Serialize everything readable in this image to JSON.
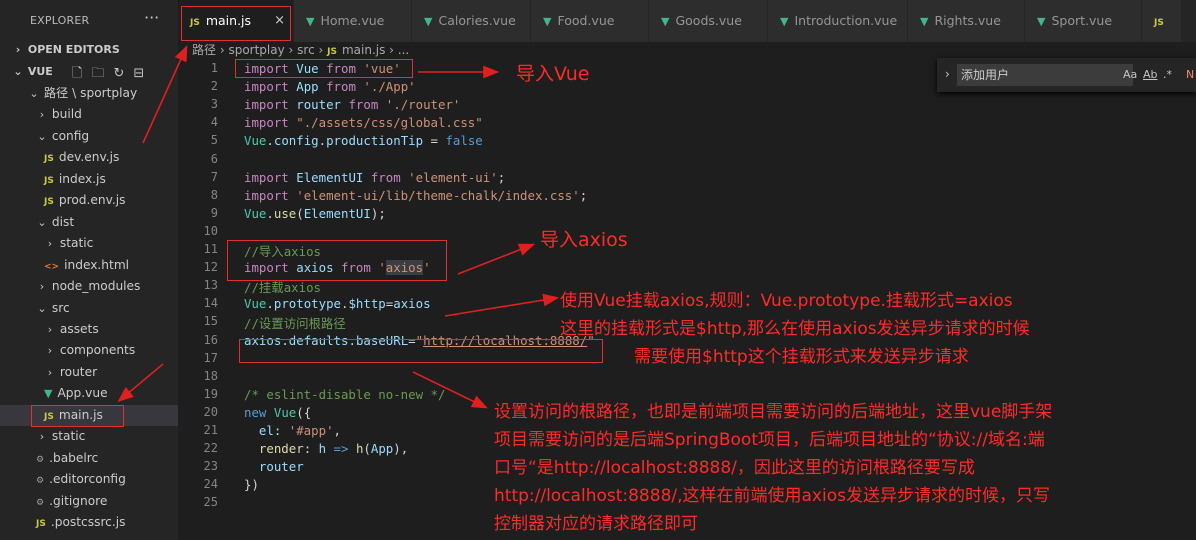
{
  "explorer": {
    "title": "EXPLORER",
    "more": "···",
    "open_editors": "OPEN EDITORS",
    "workspace": "VUE",
    "tree": [
      {
        "label": "路径 \\ sportplay",
        "type": "folder-open",
        "depth": 1
      },
      {
        "label": "build",
        "type": "folder",
        "depth": 2
      },
      {
        "label": "config",
        "type": "folder-open",
        "depth": 2
      },
      {
        "label": "dev.env.js",
        "type": "js",
        "depth": 3
      },
      {
        "label": "index.js",
        "type": "js",
        "depth": 3
      },
      {
        "label": "prod.env.js",
        "type": "js",
        "depth": 3
      },
      {
        "label": "dist",
        "type": "folder-open",
        "depth": 2
      },
      {
        "label": "static",
        "type": "folder",
        "depth": 3
      },
      {
        "label": "index.html",
        "type": "html",
        "depth": 3
      },
      {
        "label": "node_modules",
        "type": "folder",
        "depth": 2
      },
      {
        "label": "src",
        "type": "folder-open",
        "depth": 2
      },
      {
        "label": "assets",
        "type": "folder",
        "depth": 3
      },
      {
        "label": "components",
        "type": "folder",
        "depth": 3
      },
      {
        "label": "router",
        "type": "folder",
        "depth": 3
      },
      {
        "label": "App.vue",
        "type": "vue",
        "depth": 3
      },
      {
        "label": "main.js",
        "type": "js",
        "depth": 3,
        "selected": true
      },
      {
        "label": "static",
        "type": "folder",
        "depth": 2
      },
      {
        "label": ".babelrc",
        "type": "cfg",
        "depth": 2
      },
      {
        "label": ".editorconfig",
        "type": "cfg",
        "depth": 2
      },
      {
        "label": ".gitignore",
        "type": "cfg",
        "depth": 2
      },
      {
        "label": ".postcssrc.js",
        "type": "js",
        "depth": 2
      }
    ]
  },
  "tabs": [
    {
      "label": "main.js",
      "type": "js",
      "active": true
    },
    {
      "label": "Home.vue",
      "type": "vue"
    },
    {
      "label": "Calories.vue",
      "type": "vue"
    },
    {
      "label": "Food.vue",
      "type": "vue"
    },
    {
      "label": "Goods.vue",
      "type": "vue"
    },
    {
      "label": "Introduction.vue",
      "type": "vue"
    },
    {
      "label": "Rights.vue",
      "type": "vue"
    },
    {
      "label": "Sport.vue",
      "type": "vue"
    },
    {
      "label": "",
      "type": "js"
    }
  ],
  "breadcrumb": {
    "parts": [
      "路径",
      "sportplay",
      "src",
      "main.js",
      "..."
    ]
  },
  "find_widget": {
    "value": "添加用户",
    "opt_case": "Aa",
    "opt_word": "Ab",
    "opt_regex": ".*",
    "result": "N"
  },
  "code": [
    {
      "n": "1",
      "html": "<span class='kw'>import</span> <span class='var'>Vue</span> <span class='kw'>from</span> <span class='str'>'vue'</span>"
    },
    {
      "n": "2",
      "html": "<span class='kw'>import</span> <span class='var'>App</span> <span class='kw'>from</span> <span class='str'>'./App'</span>"
    },
    {
      "n": "3",
      "html": "<span class='kw'>import</span> <span class='var'>router</span> <span class='kw'>from</span> <span class='str'>'./router'</span>"
    },
    {
      "n": "4",
      "html": "<span class='kw'>import</span> <span class='str'>\"./assets/css/global.css\"</span>"
    },
    {
      "n": "5",
      "html": "<span class='cls'>Vue</span>.<span class='var'>config</span>.<span class='var'>productionTip</span> = <span class='kb'>false</span>"
    },
    {
      "n": "6",
      "html": ""
    },
    {
      "n": "7",
      "html": "<span class='kw'>import</span> <span class='var'>ElementUI</span> <span class='kw'>from</span> <span class='str'>'element-ui'</span>;"
    },
    {
      "n": "8",
      "html": "<span class='kw'>import</span> <span class='str'>'element-ui/lib/theme-chalk/index.css'</span>;"
    },
    {
      "n": "9",
      "html": "<span class='cls'>Vue</span>.<span class='fn'>use</span>(<span class='var'>ElementUI</span>);"
    },
    {
      "n": "10",
      "html": ""
    },
    {
      "n": "11",
      "html": "<span class='cm'>//导入axios</span>"
    },
    {
      "n": "12",
      "html": "<span class='kw'>import</span> <span class='var'>axios</span> <span class='kw'>from</span> <span class='str'>'<span class='hl'>axios</span>'</span>"
    },
    {
      "n": "13",
      "html": "<span class='cm'>//挂载axios</span>"
    },
    {
      "n": "14",
      "html": "<span class='cls'>Vue</span>.<span class='var'>prototype</span>.<span class='var'>$http</span>=<span class='var'>axios</span>"
    },
    {
      "n": "15",
      "html": "<span class='cm'>//设置访问根路径</span>"
    },
    {
      "n": "16",
      "html": "<span class='var'>axios</span>.<span class='var'>defaults</span>.<span class='var'>baseURL</span>=<span class='str'>\"<span class='ul'>http://localhost:8888/</span>\"</span>"
    },
    {
      "n": "17",
      "html": ""
    },
    {
      "n": "18",
      "html": ""
    },
    {
      "n": "19",
      "html": "<span class='cm'>/* eslint-disable no-new */</span>"
    },
    {
      "n": "20",
      "html": "<span class='kb'>new</span> <span class='cls'>Vue</span>({"
    },
    {
      "n": "21",
      "html": "  <span class='var'>el</span>: <span class='str'>'#app'</span>,"
    },
    {
      "n": "22",
      "html": "  <span class='fn'>render</span>: <span class='var'>h</span> <span class='kb'>=&gt;</span> <span class='fn'>h</span>(<span class='var'>App</span>),"
    },
    {
      "n": "23",
      "html": "  <span class='var'>router</span>"
    },
    {
      "n": "24",
      "html": "})"
    },
    {
      "n": "25",
      "html": ""
    }
  ],
  "annotations": {
    "import_vue": "导入Vue",
    "import_axios": "导入axios",
    "mount_line1": "使用Vue挂载axios,规则：Vue.prototype.挂载形式=axios",
    "mount_line2": "这里的挂载形式是$http,那么在使用axios发送异步请求的时候",
    "mount_line3": "需要使用$http这个挂载形式来发送异步请求",
    "base_line1": "设置访问的根路径，也即是前端项目需要访问的后端地址，这里vue脚手架",
    "base_line2": "项目需要访问的是后端SpringBoot项目，后端项目地址的“协议://域名:端",
    "base_line3": "口号“是http://localhost:8888/，因此这里的访问根路径要写成",
    "base_line4": "http://localhost:8888/,这样在前端使用axios发送异步请求的时候，只写",
    "base_line5": "控制器对应的请求路径即可"
  },
  "colors": {
    "annotation": "#ff2a2a",
    "editor_bg": "#1e1e1e",
    "sidebar_bg": "#252526"
  }
}
